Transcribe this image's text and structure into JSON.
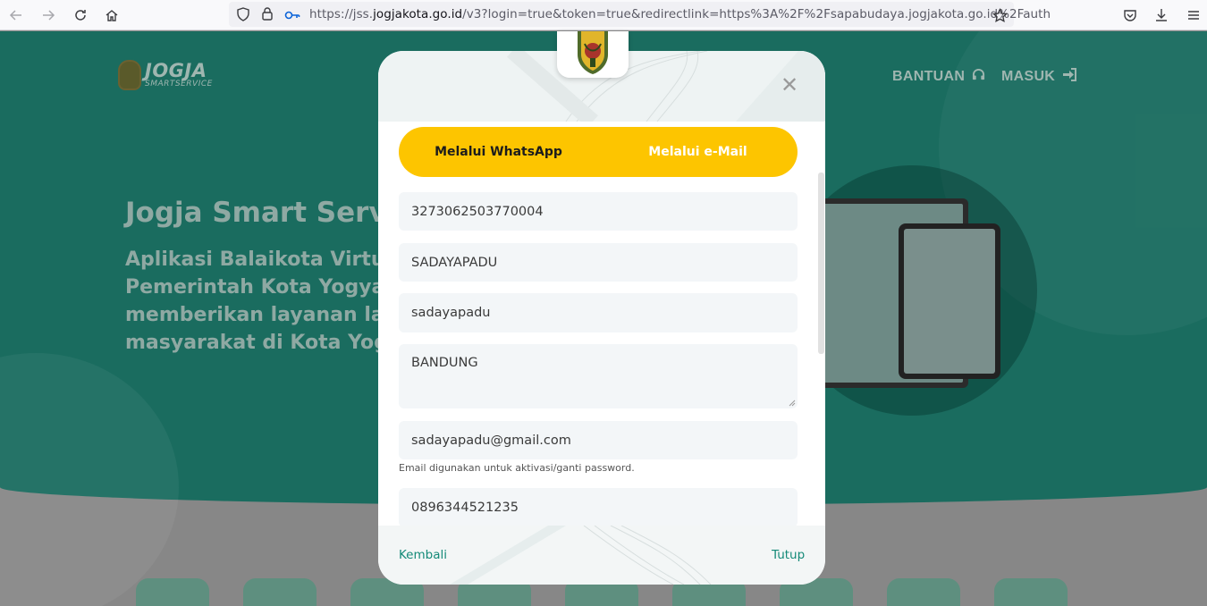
{
  "browser": {
    "url_prefix": "https://jss.",
    "url_domain": "jogjakota.go.id",
    "url_suffix": "/v3?login=true&token=true&redirectlink=https%3A%2F%2Fsapabudaya.jogjakota.go.id%2Fauth"
  },
  "site": {
    "logo_title": "JOGJA",
    "logo_subtitle": "SMARTSERVICE",
    "nav": [
      {
        "label": "BANTUAN",
        "icon": "headset-icon"
      },
      {
        "label": "MASUK",
        "icon": "sign-in-icon"
      }
    ],
    "hero_title": "Jogja Smart Servi",
    "hero_lines": [
      "Aplikasi Balaikota Virtual d",
      "Pemerintah Kota Yogyaka",
      "memberikan layanan lan",
      "masyarakat di Kota Yogy"
    ]
  },
  "modal": {
    "tabs": [
      {
        "label": "Melalui WhatsApp",
        "active": true
      },
      {
        "label": "Melalui e-Mail",
        "active": false
      }
    ],
    "fields": {
      "nik": "3273062503770004",
      "name": "SADAYAPADU",
      "username": "sadayapadu",
      "address": "BANDUNG",
      "email": "sadayapadu@gmail.com",
      "email_hint": "Email digunakan untuk aktivasi/ganti password.",
      "phone": "0896344521235"
    },
    "back_label": "Kembali",
    "close_label": "Tutup"
  },
  "colors": {
    "hero": "#1a6c5f",
    "toggle": "#fdc500",
    "link": "#148a78"
  }
}
